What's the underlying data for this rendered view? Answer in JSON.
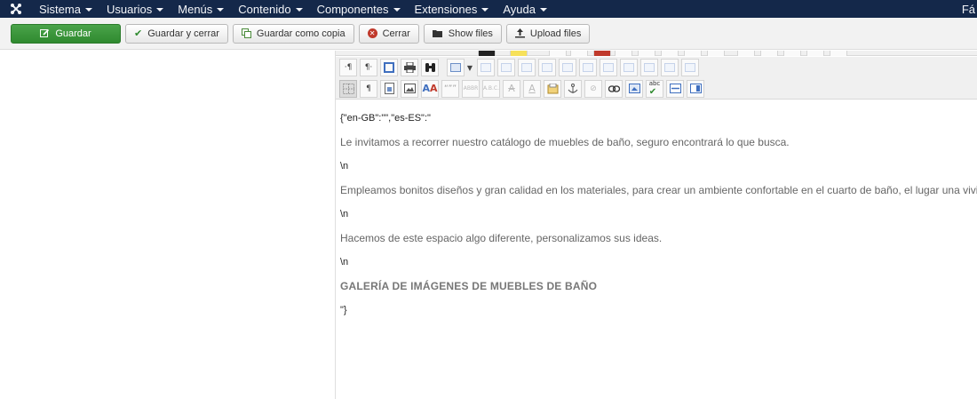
{
  "navbar": {
    "logo_icon": "joomla-logo-icon",
    "items": [
      "Sistema",
      "Usuarios",
      "Menús",
      "Contenido",
      "Componentes",
      "Extensiones",
      "Ayuda"
    ],
    "right_text": "Fá"
  },
  "toolbar": {
    "save": "Guardar",
    "save_close": "Guardar y cerrar",
    "save_copy": "Guardar como copia",
    "close": "Cerrar",
    "show_files": "Show files",
    "upload_files": "Upload files"
  },
  "editor": {
    "lines": {
      "json_open": "{\"en-GB\":\"\",\"es-ES\":\"",
      "p1": "Le invitamos a recorrer nuestro catálogo de muebles de baño, seguro encontrará lo que busca.",
      "nl1": "\\n",
      "p2": "Empleamos bonitos diseños y gran calidad en los materiales, para crear un ambiente confortable en el cuarto de baño, el lugar una vivienda.",
      "nl2": "\\n",
      "p3": "Hacemos de este espacio algo diferente, personalizamos sus ideas.",
      "nl3": "\\n",
      "heading": "GALERÍA DE IMÁGENES DE MUEBLES DE BAÑO",
      "json_close": "\"}"
    }
  },
  "colors": {
    "navbar_bg": "#14284a",
    "save_green": "#3c9a3c",
    "close_red": "#c0392b"
  }
}
